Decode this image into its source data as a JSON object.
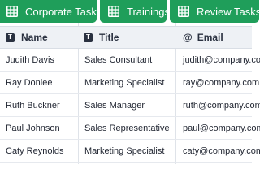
{
  "tabs": [
    {
      "label": "Corporate Tasks",
      "icon": "table-icon"
    },
    {
      "label": "Trainings",
      "icon": "table-icon"
    },
    {
      "label": "Review Tasks",
      "icon": "table-icon"
    }
  ],
  "table": {
    "columns": [
      {
        "label": "Name",
        "icon": "text-type-icon",
        "icon_glyph": "T"
      },
      {
        "label": "Title",
        "icon": "text-type-icon",
        "icon_glyph": "T"
      },
      {
        "label": "Email",
        "icon": "at-sign-icon",
        "icon_glyph": "@"
      }
    ],
    "rows": [
      {
        "name": "Judith Davis",
        "title": "Sales Consultant",
        "email": "judith@company.com"
      },
      {
        "name": "Ray Doniee",
        "title": "Marketing Specialist",
        "email": "ray@company.com"
      },
      {
        "name": "Ruth Buckner",
        "title": "Sales Manager",
        "email": "ruth@company.com"
      },
      {
        "name": "Paul Johnson",
        "title": "Sales Representative",
        "email": "paul@company.com"
      },
      {
        "name": "Caty Reynolds",
        "title": "Marketing Specialist",
        "email": "caty@company.com"
      }
    ]
  },
  "colors": {
    "tab_green": "#1f9e5a",
    "header_bg": "#eef1f5",
    "grid_line": "#dfe3e9"
  }
}
